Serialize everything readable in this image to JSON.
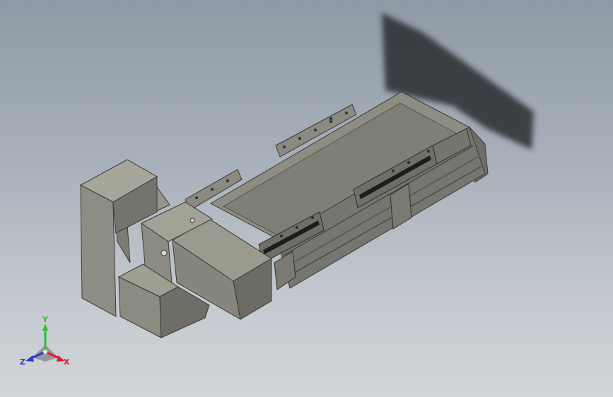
{
  "viewport": {
    "background_top": "#8f9aa6",
    "background_bottom": "#d2d6da",
    "model_color": "#8a8a80",
    "shadow_color": "#2e3138"
  },
  "triad": {
    "x_label": "X",
    "y_label": "Y",
    "z_label": "Z",
    "x_color": "#e0202a",
    "y_color": "#2cc02c",
    "z_color": "#2a3cd8"
  }
}
